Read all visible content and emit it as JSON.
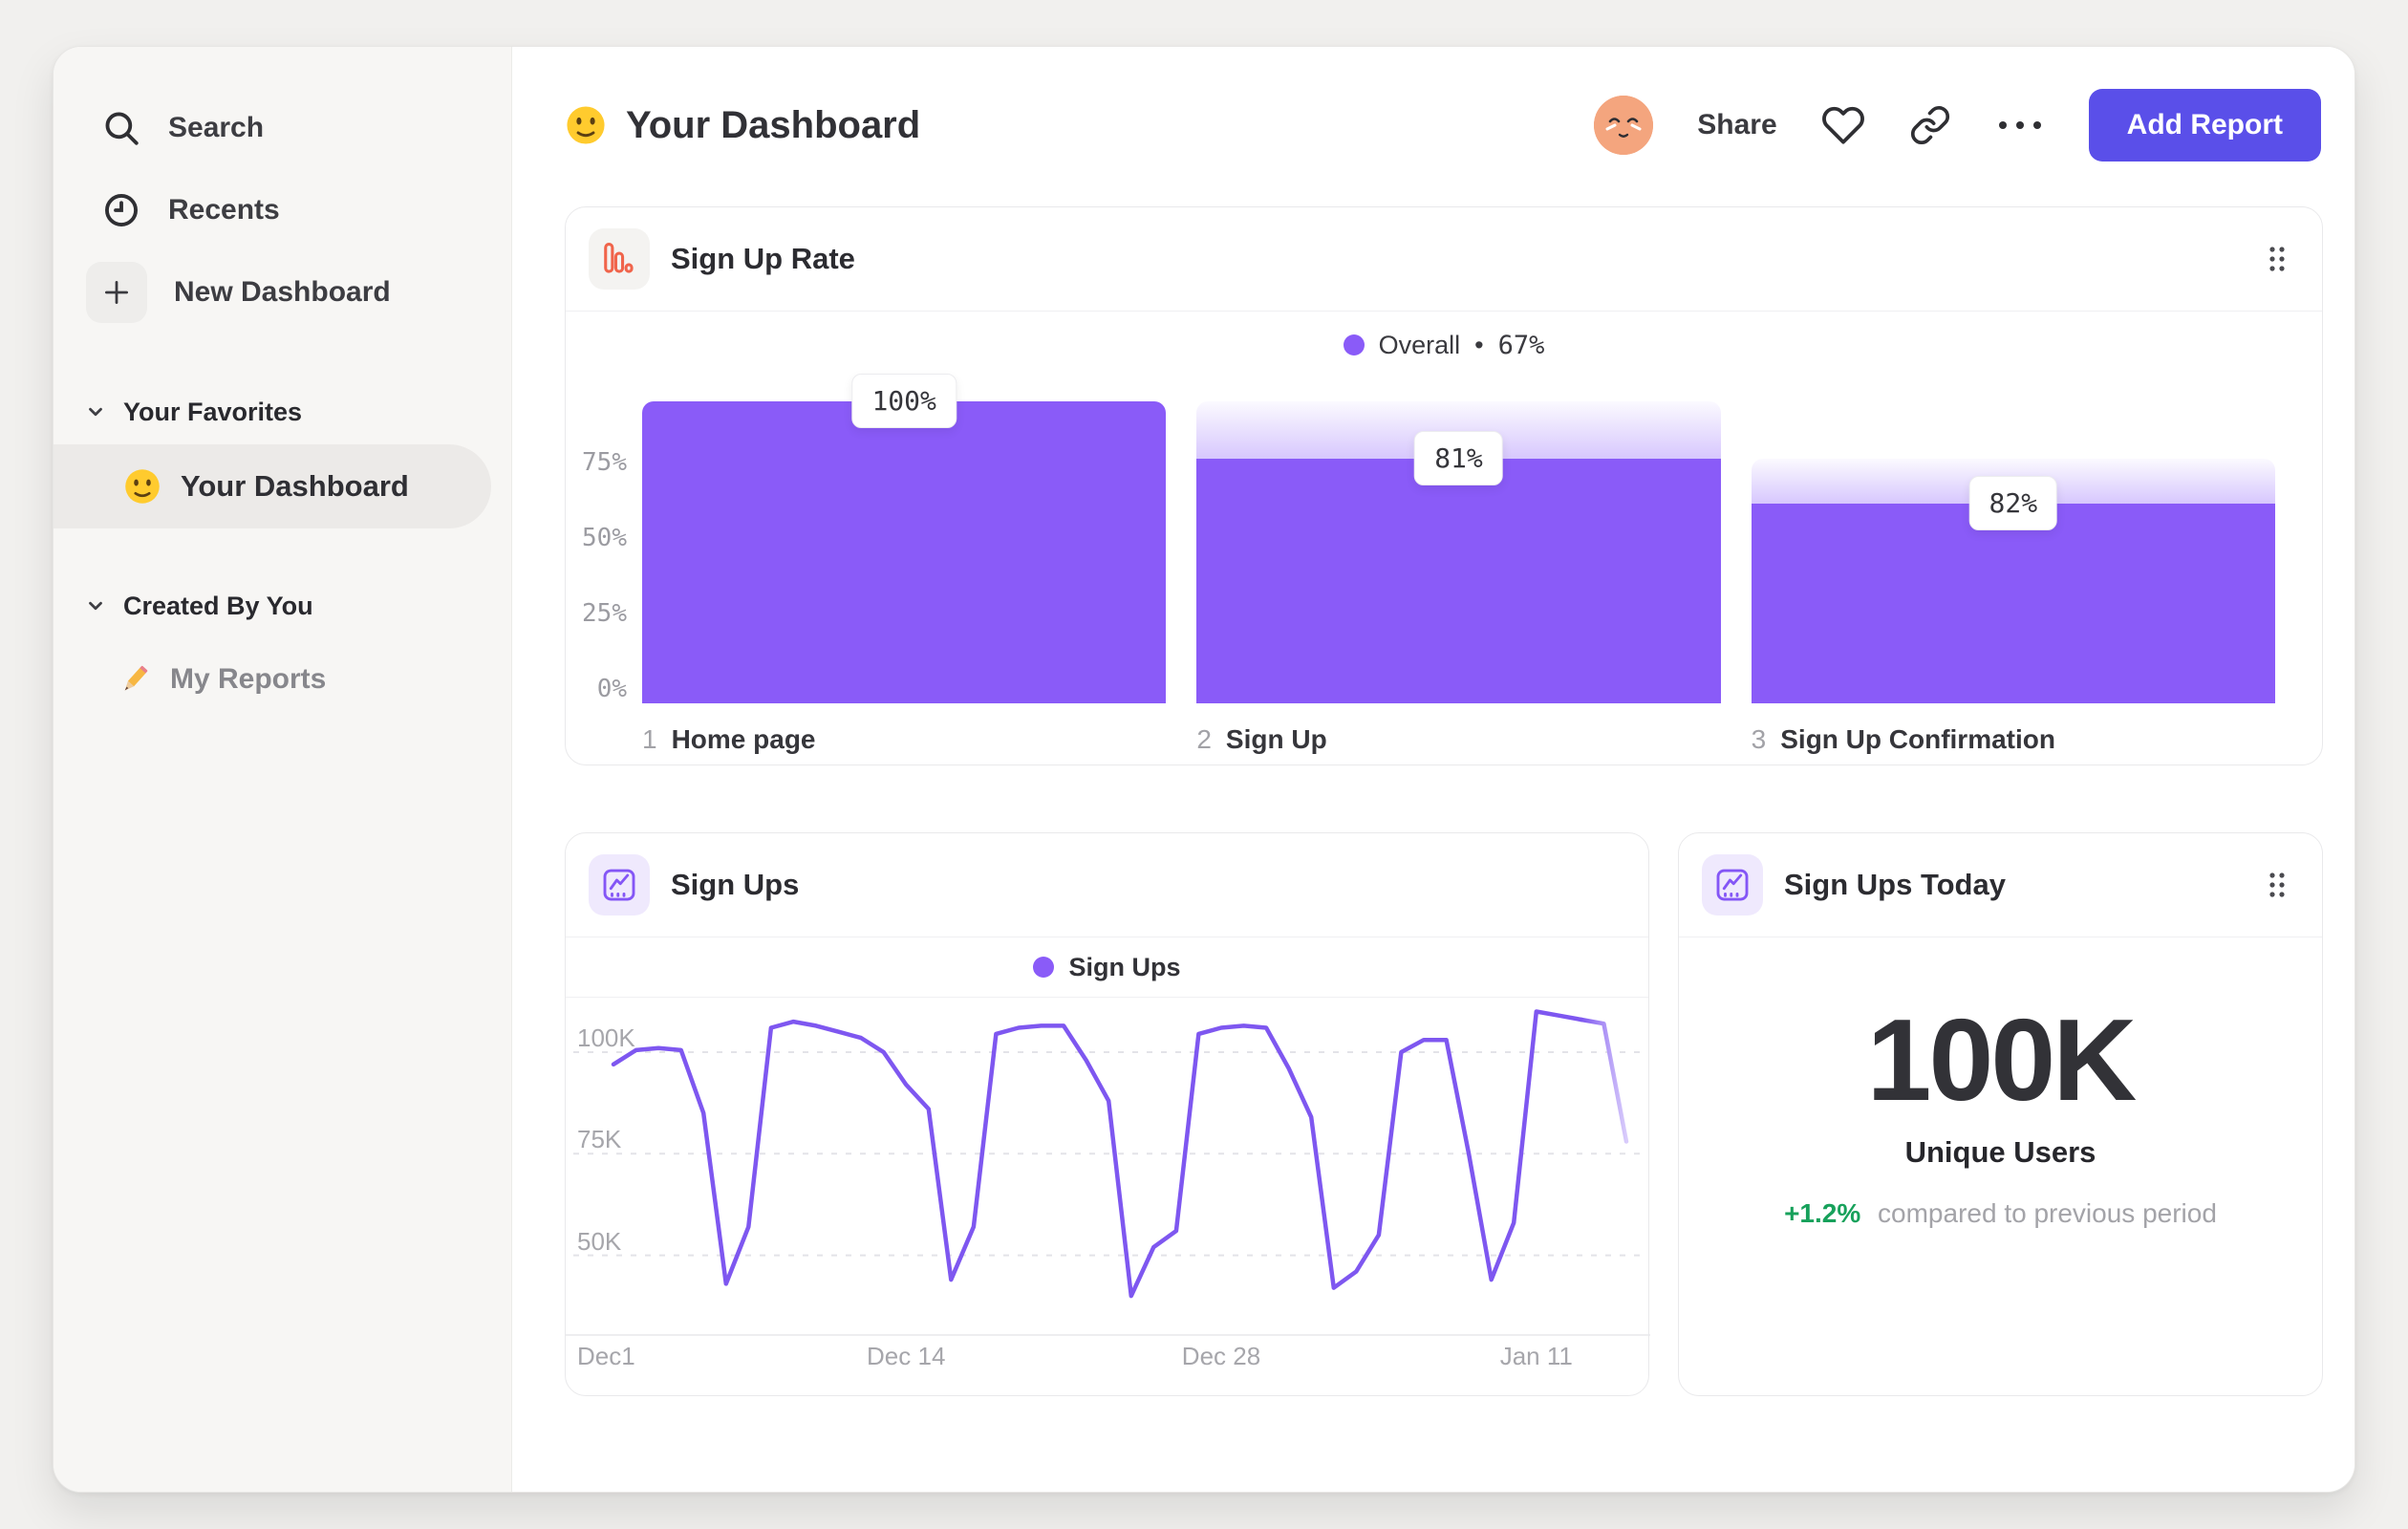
{
  "sidebar": {
    "items": [
      {
        "icon": "search-icon",
        "label": "Search"
      },
      {
        "icon": "clock-icon",
        "label": "Recents"
      },
      {
        "icon": "plus-icon",
        "label": "New Dashboard"
      }
    ],
    "sections": [
      {
        "label": "Your Favorites",
        "items": [
          {
            "icon": "smiley-emoji-icon",
            "label": "Your Dashboard",
            "selected": true
          }
        ]
      },
      {
        "label": "Created By You",
        "items": [
          {
            "icon": "pencil-emoji-icon",
            "label": "My Reports",
            "selected": false
          }
        ]
      }
    ]
  },
  "header": {
    "emoji_icon": "slightly-smiling-face",
    "title": "Your Dashboard",
    "share_label": "Share",
    "add_report_label": "Add Report"
  },
  "colors": {
    "accent_purple": "#8A5BF8",
    "line_purple": "#7E57F0",
    "button_purple": "#5A4FE9",
    "icon_orange": "#F0644B",
    "delta_green": "#17A15B",
    "avatar_peach": "#F4A57E"
  },
  "chart_data": [
    {
      "type": "bar",
      "subtype": "funnel",
      "title": "Sign Up Rate",
      "legend": {
        "name": "Overall",
        "sep": "•",
        "value": "67%"
      },
      "ylim": [
        0,
        100
      ],
      "yticks": [
        {
          "label": "75%",
          "pct": 75
        },
        {
          "label": "50%",
          "pct": 50
        },
        {
          "label": "25%",
          "pct": 25
        },
        {
          "label": "0%",
          "pct": 0
        }
      ],
      "steps": [
        {
          "step": "1",
          "label": "Home page",
          "conversion_label": "100%",
          "overall_pct": 100,
          "prev_pct": null
        },
        {
          "step": "2",
          "label": "Sign Up",
          "conversion_label": "81%",
          "overall_pct": 81,
          "prev_pct": 100
        },
        {
          "step": "3",
          "label": "Sign Up Confirmation",
          "conversion_label": "82%",
          "overall_pct": 66,
          "prev_pct": 81
        }
      ]
    },
    {
      "type": "line",
      "title": "Sign Ups",
      "legend": "Sign Ups",
      "ylabels": [
        {
          "label": "100K",
          "value": 100
        },
        {
          "label": "75K",
          "value": 75
        },
        {
          "label": "50K",
          "value": 50
        }
      ],
      "xticks": [
        {
          "label": "Dec1",
          "index": 0
        },
        {
          "label": "Dec 14",
          "index": 13
        },
        {
          "label": "Dec 28",
          "index": 27
        },
        {
          "label": "Jan 11",
          "index": 41
        }
      ],
      "unit": "K",
      "values": [
        97,
        100.5,
        101,
        100.5,
        85,
        43,
        57,
        106,
        107.5,
        106.5,
        105,
        103.5,
        100,
        92,
        86,
        44,
        57,
        104.5,
        106,
        106.5,
        106.5,
        98,
        88,
        40,
        52,
        56,
        104.5,
        106,
        106.5,
        106,
        96,
        84,
        42,
        46,
        55,
        100,
        103,
        103,
        75,
        44,
        58,
        110,
        109,
        108,
        107,
        78
      ],
      "fade_from_index": 43,
      "grid": "dashed-horizontal",
      "legend_position": "top-center"
    },
    {
      "type": "metric",
      "title": "Sign Ups Today",
      "value": "100K",
      "label": "Unique Users",
      "delta": "+1.2%",
      "delta_note": "compared to previous period"
    }
  ]
}
